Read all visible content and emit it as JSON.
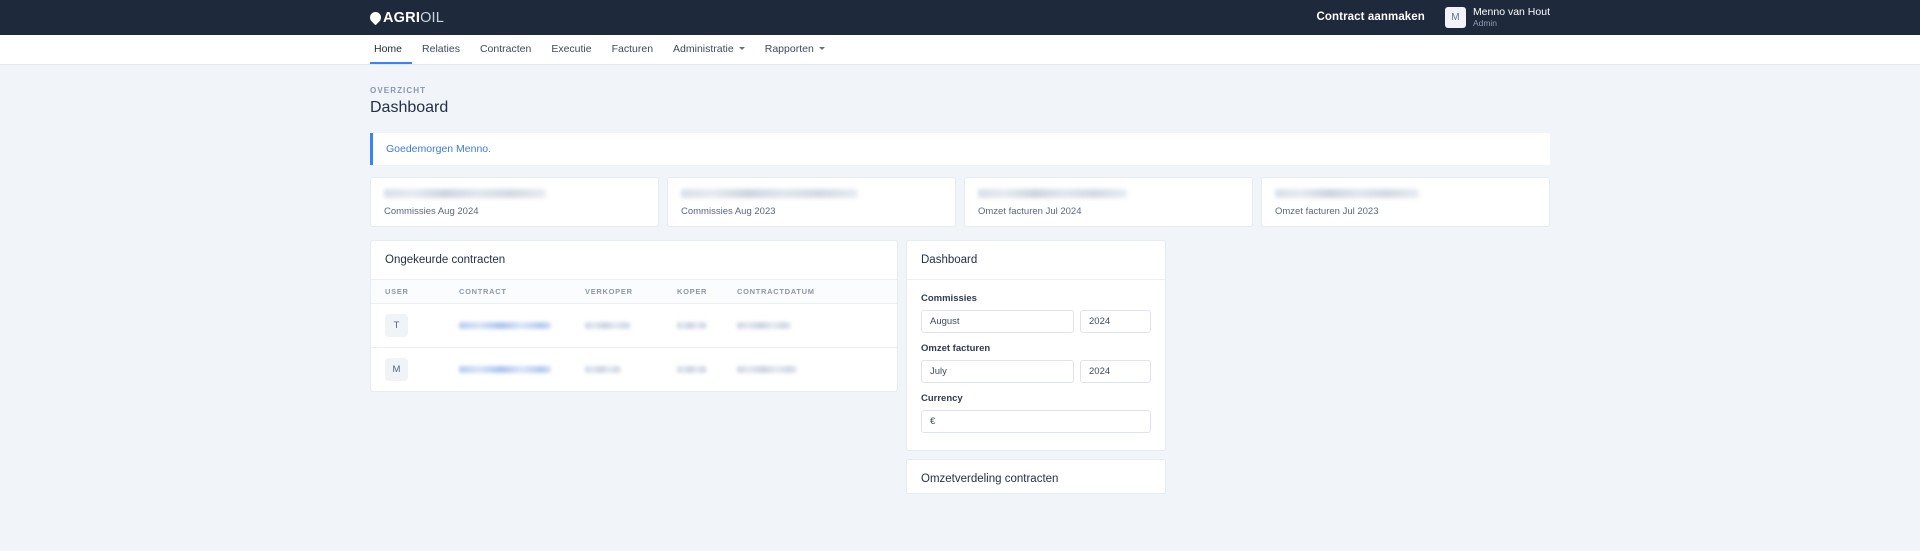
{
  "topbar": {
    "logo_primary": "AGRI",
    "logo_secondary": "OIL",
    "logo_icon": "droplet-icon",
    "create_button": "Contract aanmaken",
    "user": {
      "initial": "M",
      "name": "Menno van Hout",
      "role": "Admin"
    }
  },
  "nav": {
    "items": [
      {
        "label": "Home",
        "active": true,
        "has_caret": false
      },
      {
        "label": "Relaties",
        "active": false,
        "has_caret": false
      },
      {
        "label": "Contracten",
        "active": false,
        "has_caret": false
      },
      {
        "label": "Executie",
        "active": false,
        "has_caret": false
      },
      {
        "label": "Facturen",
        "active": false,
        "has_caret": false
      },
      {
        "label": "Administratie",
        "active": false,
        "has_caret": true
      },
      {
        "label": "Rapporten",
        "active": false,
        "has_caret": true
      }
    ]
  },
  "page": {
    "eyebrow": "OVERZICHT",
    "title": "Dashboard",
    "greeting": "Goedemorgen Menno."
  },
  "stats": [
    {
      "value": "",
      "label": "Commissies Aug 2024"
    },
    {
      "value": "",
      "label": "Commissies Aug 2023"
    },
    {
      "value": "",
      "label": "Omzet facturen Jul 2024"
    },
    {
      "value": "",
      "label": "Omzet facturen Jul 2023"
    }
  ],
  "contracts_card": {
    "title": "Ongekeurde contracten",
    "columns": [
      "USER",
      "CONTRACT",
      "VERKOPER",
      "KOPER",
      "CONTRACTDATUM"
    ],
    "rows": [
      {
        "user_initial": "T",
        "contract": "",
        "verkoper": "",
        "koper": "",
        "contractdatum": ""
      },
      {
        "user_initial": "M",
        "contract": "",
        "verkoper": "",
        "koper": "",
        "contractdatum": ""
      }
    ]
  },
  "settings_panel": {
    "title": "Dashboard",
    "commissies_label": "Commissies",
    "commissies_month": "August",
    "commissies_year": "2024",
    "omzet_label": "Omzet facturen",
    "omzet_month": "July",
    "omzet_year": "2024",
    "currency_label": "Currency",
    "currency_value": "€"
  },
  "bottom_card": {
    "title": "Omzetverdeling contracten"
  },
  "colors": {
    "header_bg": "#1e293b",
    "accent_blue": "#3b82f6",
    "page_bg": "#f1f4f9",
    "link_blue": "#3c7ae0"
  }
}
